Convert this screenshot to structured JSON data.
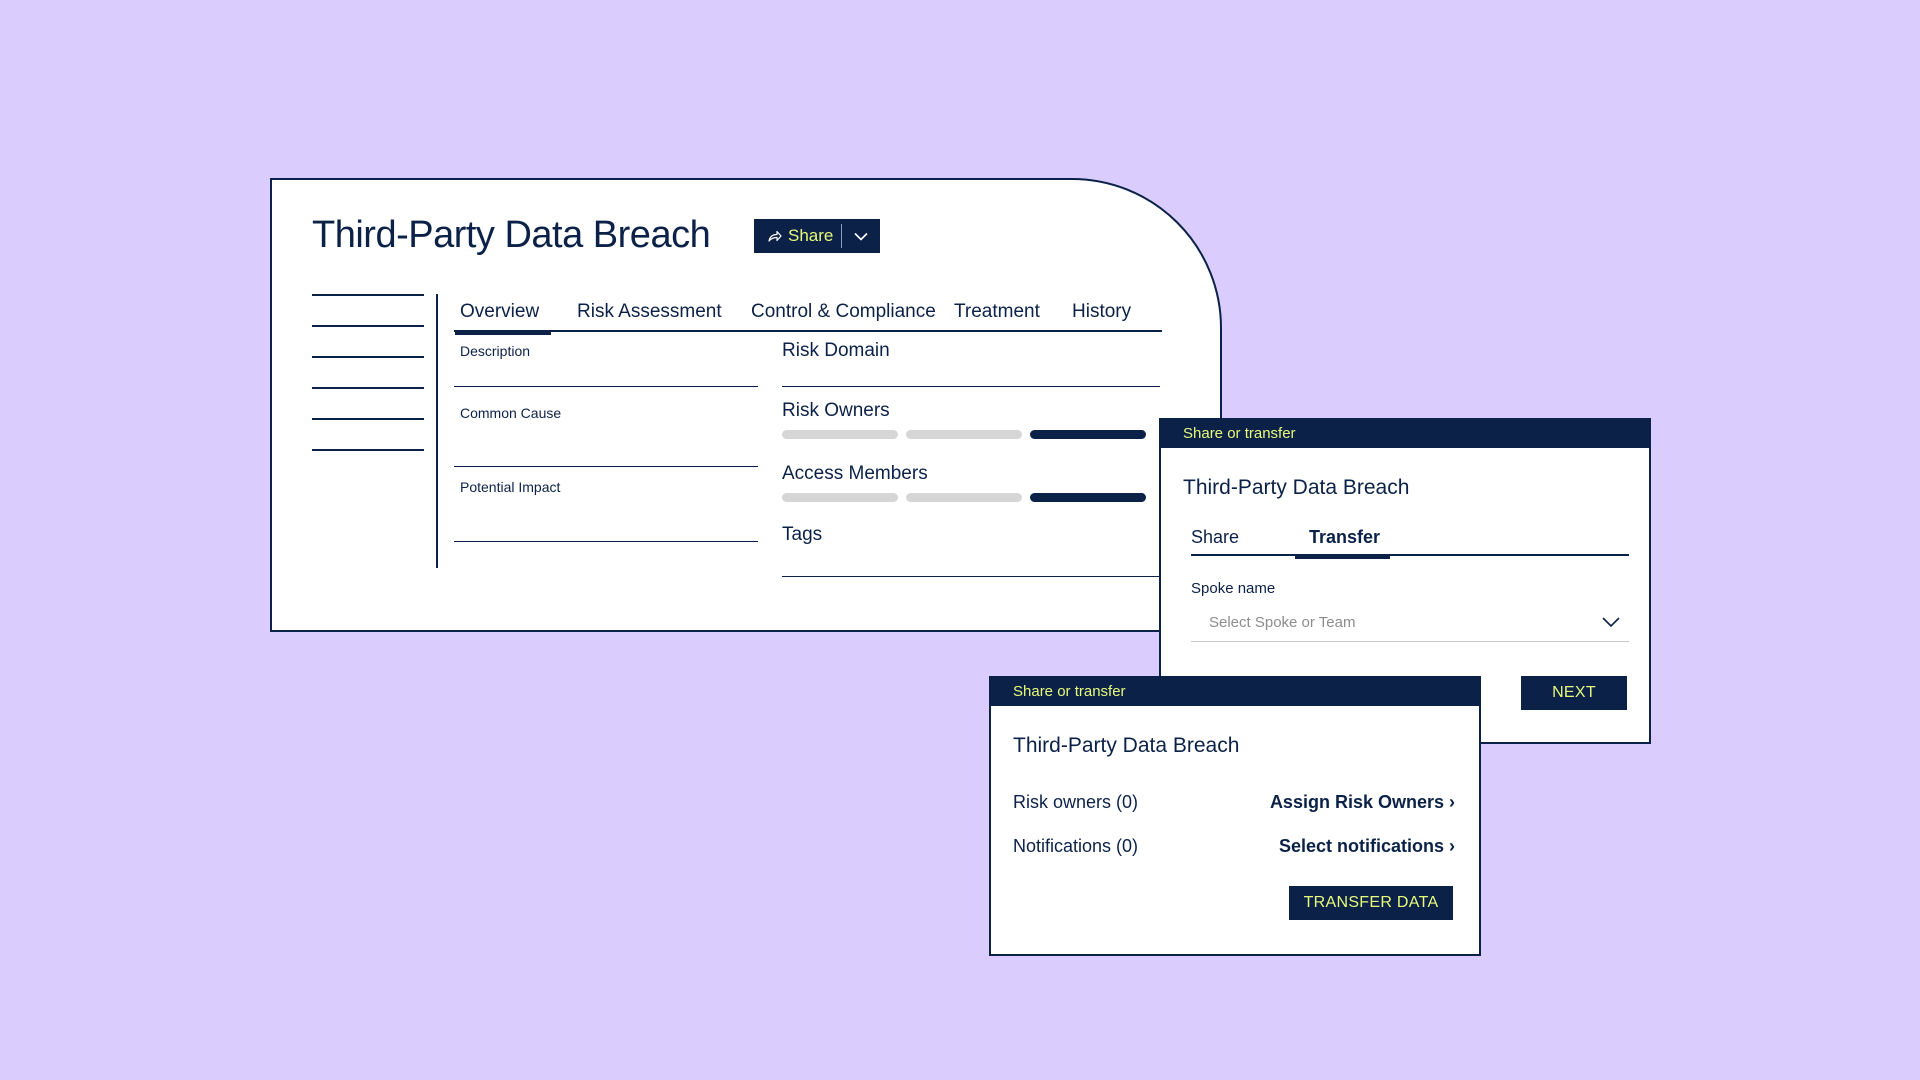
{
  "main": {
    "title": "Third-Party Data Breach",
    "share_label": "Share",
    "tabs": [
      {
        "label": "Overview",
        "active": true
      },
      {
        "label": "Risk Assessment",
        "active": false
      },
      {
        "label": "Control & Compliance",
        "active": false
      },
      {
        "label": "Treatment",
        "active": false
      },
      {
        "label": "History",
        "active": false
      }
    ],
    "left_fields": [
      "Description",
      "Common Cause",
      "Potential Impact"
    ],
    "right_fields": [
      "Risk Domain",
      "Risk Owners",
      "Access Members",
      "Tags"
    ]
  },
  "transfer_dialog": {
    "header": "Share or transfer",
    "title": "Third-Party Data Breach",
    "tabs": [
      {
        "label": "Share",
        "active": false
      },
      {
        "label": "Transfer",
        "active": true
      }
    ],
    "field_label": "Spoke name",
    "select_placeholder": "Select Spoke or Team",
    "next_label": "NEXT"
  },
  "assign_dialog": {
    "header": "Share or transfer",
    "title": "Third-Party Data Breach",
    "risk_owners_label": "Risk owners (0)",
    "assign_link": "Assign Risk Owners ›",
    "notifications_label": "Notifications (0)",
    "notifications_link": "Select notifications ›",
    "transfer_label": "TRANSFER DATA"
  },
  "colors": {
    "background": "#dacdfe",
    "navy": "#0b2148",
    "accent": "#e7fa7a",
    "bar_light": "#d6d6d6"
  }
}
